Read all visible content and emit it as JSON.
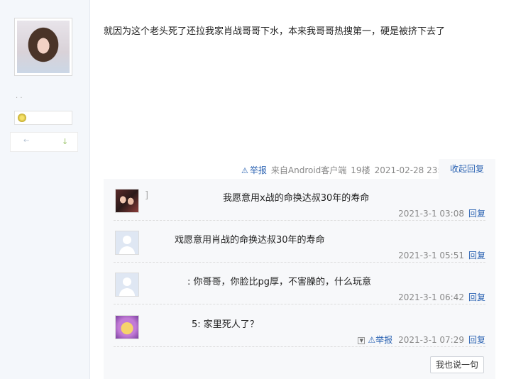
{
  "post": {
    "text": "就因为这个老头死了还拉我家肖战哥哥下水，本来我哥哥热搜第一，硬是被挤下去了",
    "report_label": "举报",
    "source": "来自Android客户端",
    "floor": "19楼",
    "time": "2021-02-28 23:58",
    "collapse_label": "收起回复"
  },
  "sidebar": {
    "dots": ". ."
  },
  "replies": [
    {
      "prefix": "]",
      "text": "我愿意用x战的命换达叔30年的寿命",
      "time": "2021-3-1 03:08",
      "reply_label": "回复"
    },
    {
      "prefix": "",
      "text": "戏愿意用肖战的命换达叔30年的寿命",
      "time": "2021-3-1 05:51",
      "reply_label": "回复"
    },
    {
      "prefix": "",
      "text": ": 你哥哥，你脸比pg厚，不害臊的，什么玩意",
      "time": "2021-3-1 06:42",
      "reply_label": "回复"
    },
    {
      "prefix": "",
      "text": "5: 家里死人了？",
      "time": "2021-3-1 07:29",
      "reply_label": "回复",
      "report_label": "举报"
    }
  ],
  "say_button": "我也说一句",
  "colors": {
    "link": "#2d64b3",
    "panel": "#f7f8fa",
    "sidebar": "#f4f7fb"
  }
}
